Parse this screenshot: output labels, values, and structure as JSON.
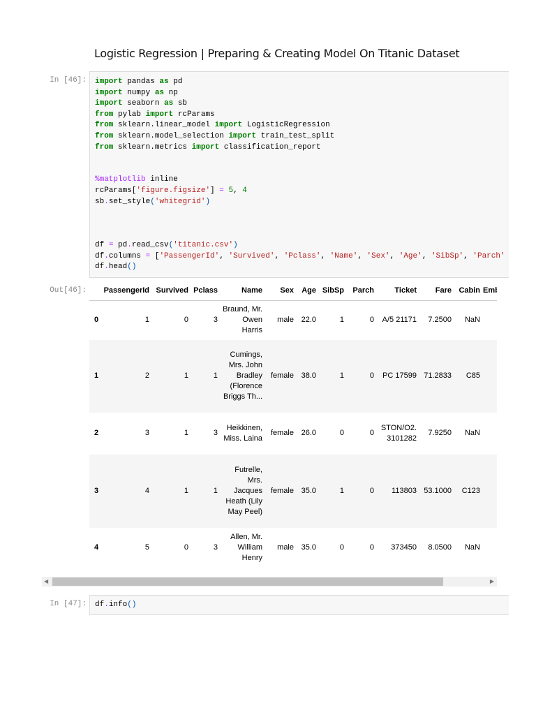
{
  "title": "Logistic Regression | Preparing & Creating Model On Titanic Dataset",
  "cells": [
    {
      "prompt": "In [46]:",
      "lines": [
        [
          [
            "import",
            "kw"
          ],
          [
            " pandas ",
            ""
          ],
          [
            "as",
            "kw"
          ],
          [
            " pd",
            ""
          ]
        ],
        [
          [
            "import",
            "kw"
          ],
          [
            " numpy ",
            ""
          ],
          [
            "as",
            "kw"
          ],
          [
            " np",
            ""
          ]
        ],
        [
          [
            "import",
            "kw"
          ],
          [
            " seaborn ",
            ""
          ],
          [
            "as",
            "kw"
          ],
          [
            " sb",
            ""
          ]
        ],
        [
          [
            "from",
            "kw"
          ],
          [
            " pylab ",
            ""
          ],
          [
            "import",
            "kw"
          ],
          [
            " rcParams",
            ""
          ]
        ],
        [
          [
            "from",
            "kw"
          ],
          [
            " sklearn.linear_model ",
            ""
          ],
          [
            "import",
            "kw"
          ],
          [
            " LogisticRegression",
            ""
          ]
        ],
        [
          [
            "from",
            "kw"
          ],
          [
            " sklearn.model_selection ",
            ""
          ],
          [
            "import",
            "kw"
          ],
          [
            " train_test_split",
            ""
          ]
        ],
        [
          [
            "from",
            "kw"
          ],
          [
            " sklearn.metrics ",
            ""
          ],
          [
            "import",
            "kw"
          ],
          [
            " classification_report",
            ""
          ]
        ],
        [],
        [],
        [
          [
            "%matplotlib",
            "magic"
          ],
          [
            " inline",
            ""
          ]
        ],
        [
          [
            "rcParams[",
            ""
          ],
          [
            "'figure.figsize'",
            "str"
          ],
          [
            "] ",
            ""
          ],
          [
            "=",
            "op"
          ],
          [
            " ",
            ""
          ],
          [
            "5",
            "num"
          ],
          [
            ", ",
            ""
          ],
          [
            "4",
            "num"
          ]
        ],
        [
          [
            "sb",
            ""
          ],
          [
            ".",
            "op"
          ],
          [
            "set_style",
            ""
          ],
          [
            "(",
            "paren"
          ],
          [
            "'whitegrid'",
            "str"
          ],
          [
            ")",
            "paren"
          ]
        ],
        [],
        [],
        [],
        [
          [
            "df ",
            ""
          ],
          [
            "=",
            "op"
          ],
          [
            " pd",
            ""
          ],
          [
            ".",
            "op"
          ],
          [
            "read_csv",
            ""
          ],
          [
            "(",
            "paren"
          ],
          [
            "'titanic.csv'",
            "str"
          ],
          [
            ")",
            "paren"
          ]
        ],
        [
          [
            "df",
            ""
          ],
          [
            ".",
            "op"
          ],
          [
            "columns ",
            ""
          ],
          [
            "=",
            "op"
          ],
          [
            " [",
            ""
          ],
          [
            "'PassengerId'",
            "str"
          ],
          [
            ", ",
            ""
          ],
          [
            "'Survived'",
            "str"
          ],
          [
            ", ",
            ""
          ],
          [
            "'Pclass'",
            "str"
          ],
          [
            ", ",
            ""
          ],
          [
            "'Name'",
            "str"
          ],
          [
            ", ",
            ""
          ],
          [
            "'Sex'",
            "str"
          ],
          [
            ", ",
            ""
          ],
          [
            "'Age'",
            "str"
          ],
          [
            ", ",
            ""
          ],
          [
            "'SibSp'",
            "str"
          ],
          [
            ", ",
            ""
          ],
          [
            "'Parch'",
            "str"
          ]
        ],
        [
          [
            "df",
            ""
          ],
          [
            ".",
            "op"
          ],
          [
            "head",
            ""
          ],
          [
            "()",
            "paren"
          ]
        ]
      ]
    },
    {
      "prompt": "In [47]:",
      "lines": [
        [
          [
            "df",
            ""
          ],
          [
            ".",
            "op"
          ],
          [
            "info",
            ""
          ],
          [
            "()",
            "paren"
          ]
        ]
      ]
    }
  ],
  "output": {
    "prompt": "Out[46]:",
    "columns": [
      "",
      "PassengerId",
      "Survived",
      "Pclass",
      "Name",
      "Sex",
      "Age",
      "SibSp",
      "Parch",
      "Ticket",
      "Fare",
      "Cabin",
      "Embarked"
    ],
    "rows": [
      [
        "0",
        "1",
        "0",
        "3",
        "Braund, Mr. Owen Harris",
        "male",
        "22.0",
        "1",
        "0",
        "A/5 21171",
        "7.2500",
        "NaN"
      ],
      [
        "1",
        "2",
        "1",
        "1",
        "Cumings, Mrs. John Bradley (Florence Briggs Th...",
        "female",
        "38.0",
        "1",
        "0",
        "PC 17599",
        "71.2833",
        "C85"
      ],
      [
        "2",
        "3",
        "1",
        "3",
        "Heikkinen, Miss. Laina",
        "female",
        "26.0",
        "0",
        "0",
        "STON/O2. 3101282",
        "7.9250",
        "NaN"
      ],
      [
        "3",
        "4",
        "1",
        "1",
        "Futrelle, Mrs. Jacques Heath (Lily May Peel)",
        "female",
        "35.0",
        "1",
        "0",
        "113803",
        "53.1000",
        "C123"
      ],
      [
        "4",
        "5",
        "0",
        "3",
        "Allen, Mr. William Henry",
        "male",
        "35.0",
        "0",
        "0",
        "373450",
        "8.0500",
        "NaN"
      ]
    ]
  },
  "scrollbar": {
    "left_icon": "arrow-left",
    "right_icon": "arrow-right",
    "position_fraction": 0.0,
    "visible_fraction": 0.9
  }
}
